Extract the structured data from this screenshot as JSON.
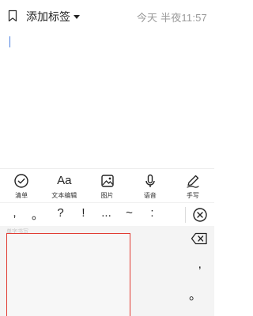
{
  "header": {
    "tag_label": "添加标签",
    "datetime": "今天 半夜11:57"
  },
  "toolbar": {
    "items": [
      {
        "icon": "check-circle-icon",
        "label": "清单"
      },
      {
        "icon": "text-format-icon",
        "glyph": "Aa",
        "label": "文本编辑"
      },
      {
        "icon": "image-icon",
        "label": "图片"
      },
      {
        "icon": "microphone-icon",
        "label": "语音"
      },
      {
        "icon": "pen-icon",
        "label": "手写"
      }
    ]
  },
  "punctuation": {
    "keys": [
      ",",
      "。",
      "?",
      "!",
      "...",
      "~",
      ":"
    ],
    "clear_icon": "close-circle-icon"
  },
  "keyboard": {
    "handwriting_label": "单字书写",
    "side_keys": [
      ",",
      "。"
    ],
    "backspace_icon": "backspace-icon"
  },
  "colors": {
    "accent": "#4a7fe0",
    "handwriting_border": "#e13b32",
    "muted_text": "#9a9a9a"
  }
}
